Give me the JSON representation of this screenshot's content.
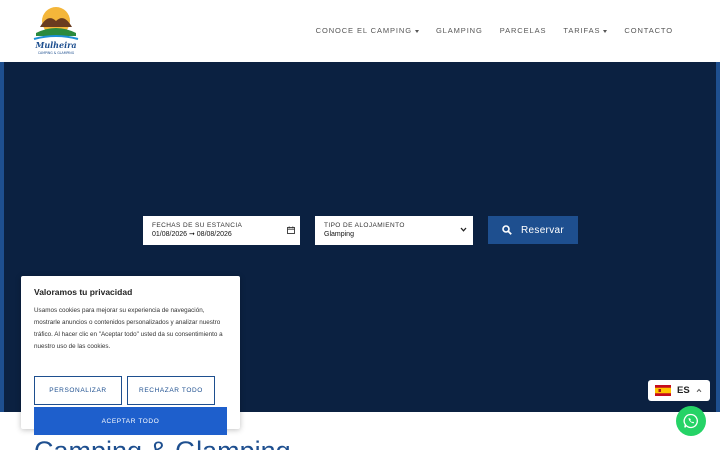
{
  "header": {
    "logo_alt": "Mulheira Camping & Glamping",
    "nav": [
      {
        "label": "CONOCE EL CAMPING",
        "dropdown": true
      },
      {
        "label": "GLAMPING",
        "dropdown": false
      },
      {
        "label": "PARCELAS",
        "dropdown": false
      },
      {
        "label": "TARIFAS",
        "dropdown": true
      },
      {
        "label": "CONTACTO",
        "dropdown": false
      }
    ]
  },
  "booking": {
    "dates_label": "FECHAS DE SU ESTANCIA",
    "dates_value": "01/08/2026 ➞ 08/08/2026",
    "type_label": "TIPO DE ALOJAMIENTO",
    "type_value": "Glamping",
    "reserve_label": "Reservar"
  },
  "cookie": {
    "title": "Valoramos tu privacidad",
    "text": "Usamos cookies para mejorar su experiencia de navegación, mostrarle anuncios o contenidos personalizados y analizar nuestro tráfico. Al hacer clic en \"Aceptar todo\" usted da su consentimiento a nuestro uso de las cookies.",
    "customize_label": "PERSONALIZAR",
    "reject_label": "RECHAZAR TODO",
    "accept_label": "ACEPTAR TODO"
  },
  "language": {
    "code": "ES"
  },
  "page": {
    "title": "Camping & Glamping"
  },
  "colors": {
    "hero": "#0b2141",
    "accent": "#1e4f8f",
    "accept": "#1e5fcc",
    "whatsapp": "#25d366"
  },
  "icons": [
    "logo-icon",
    "calendar-icon",
    "chevron-down-icon",
    "search-icon",
    "spain-flag-icon",
    "chevron-up-icon",
    "whatsapp-icon"
  ]
}
